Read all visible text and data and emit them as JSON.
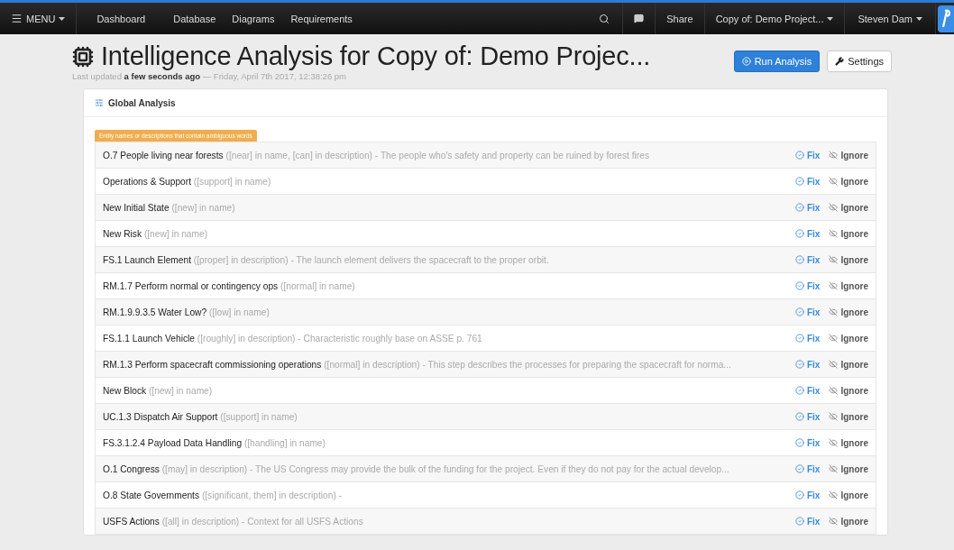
{
  "navbar": {
    "menu": "MENU",
    "links": [
      {
        "label": "Dashboard"
      },
      {
        "label": "Database"
      },
      {
        "label": "Diagrams"
      },
      {
        "label": "Requirements"
      }
    ],
    "share": "Share",
    "project": "Copy of: Demo Project...",
    "user": "Steven Dam"
  },
  "header": {
    "title": "Intelligence Analysis for Copy of: Demo Projec...",
    "updated": "Last updated **a few seconds ago** — Friday, April 7th 2017, 12:38:26 pm",
    "run_button": "Run Analysis",
    "settings_button": "Settings"
  },
  "panel": {
    "title": "Global Analysis",
    "tag": "Entity names or descriptions that contain ambiguous words",
    "rows": [
      {
        "name": "O.7 People living near forests",
        "detail": "([near] in name, [can] in description) - The people who's safety and property can be ruined by forest fires",
        "fix": "Fix",
        "ignore": "Ignore"
      },
      {
        "name": "Operations & Support",
        "detail": "([support] in name)",
        "fix": "Fix",
        "ignore": "Ignore"
      },
      {
        "name": "New Initial State",
        "detail": "([new] in name)",
        "fix": "Fix",
        "ignore": "Ignore"
      },
      {
        "name": "New Risk",
        "detail": "([new] in name)",
        "fix": "Fix",
        "ignore": "Ignore"
      },
      {
        "name": "FS.1 Launch Element",
        "detail": "([proper] in description) - The launch element delivers the spacecraft to the proper orbit.",
        "fix": "Fix",
        "ignore": "Ignore"
      },
      {
        "name": "RM.1.7 Perform normal or contingency ops",
        "detail": "([normal] in name)",
        "fix": "Fix",
        "ignore": "Ignore"
      },
      {
        "name": "RM.1.9.9.3.5 Water Low?",
        "detail": "([low] in name)",
        "fix": "Fix",
        "ignore": "Ignore"
      },
      {
        "name": "FS.1.1 Launch Vehicle",
        "detail": "([roughly] in description) - Characteristic roughly base on ASSE p. 761",
        "fix": "Fix",
        "ignore": "Ignore"
      },
      {
        "name": "RM.1.3 Perform spacecraft commissioning operations",
        "detail": "([normal] in description) - This step describes the processes for preparing the spacecraft for norma...",
        "fix": "Fix",
        "ignore": "Ignore"
      },
      {
        "name": "New Block",
        "detail": "([new] in name)",
        "fix": "Fix",
        "ignore": "Ignore"
      },
      {
        "name": "UC.1.3 Dispatch Air Support",
        "detail": "([support] in name)",
        "fix": "Fix",
        "ignore": "Ignore"
      },
      {
        "name": "FS.3.1.2.4 Payload Data Handling",
        "detail": "([handling] in name)",
        "fix": "Fix",
        "ignore": "Ignore"
      },
      {
        "name": "O.1 Congress",
        "detail": "([may] in description) - The US Congress may provide the bulk of the funding for the project. Even if they do not pay for the actual develop...",
        "fix": "Fix",
        "ignore": "Ignore"
      },
      {
        "name": "O.8 State Governments",
        "detail": "([significant, them] in description) -",
        "fix": "Fix",
        "ignore": "Ignore"
      },
      {
        "name": "USFS Actions",
        "detail": "([all] in description) - Context for all USFS Actions",
        "fix": "Fix",
        "ignore": "Ignore"
      }
    ]
  }
}
